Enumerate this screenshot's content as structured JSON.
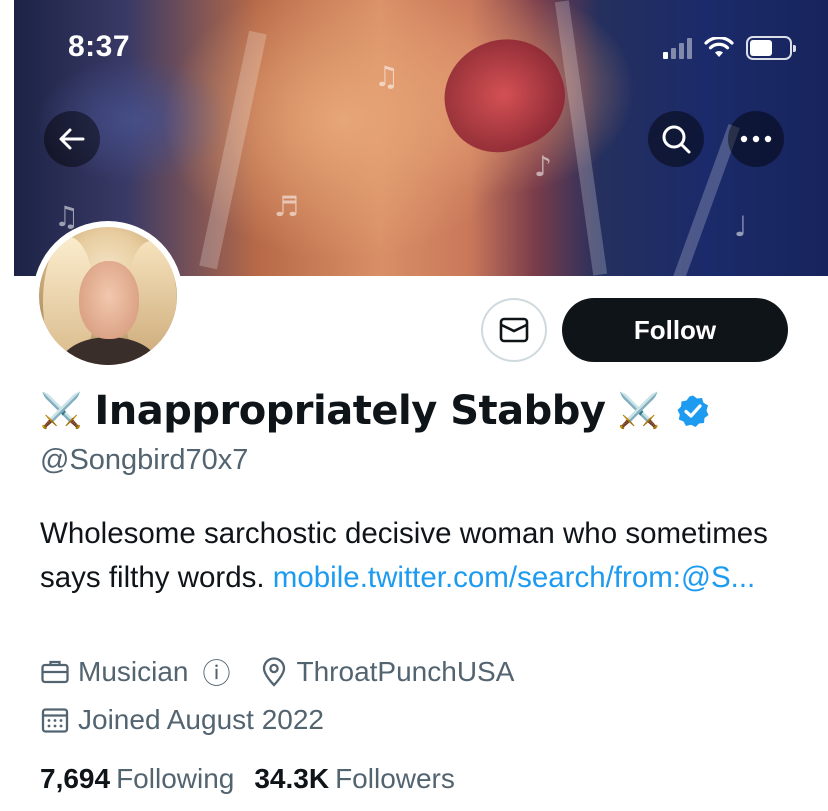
{
  "status_bar": {
    "time": "8:37"
  },
  "header": {
    "back_icon": "arrow-left-icon",
    "search_icon": "search-icon",
    "more_icon": "more-horizontal-icon"
  },
  "profile": {
    "display_name": "Inappropriately Stabby",
    "name_emoji": "⚔️",
    "handle": "@Songbird70x7",
    "verified": true,
    "bio_text": "Wholesome sarchostic decisive woman who sometimes says filthy words. ",
    "bio_link": "mobile.twitter.com/search/from:@S...",
    "profession": "Musician",
    "profession_info_glyph": "ⓘ",
    "location": "ThroatPunchUSA",
    "joined": "Joined August 2022",
    "following_count": "7,694",
    "following_label": "Following",
    "followers_count": "34.3K",
    "followers_label": "Followers"
  },
  "actions": {
    "message_icon": "mail-icon",
    "follow_label": "Follow"
  },
  "colors": {
    "link": "#1d9bf0",
    "verified": "#1d9bf0",
    "follow_bg": "#0f1419",
    "secondary_text": "#536471"
  }
}
